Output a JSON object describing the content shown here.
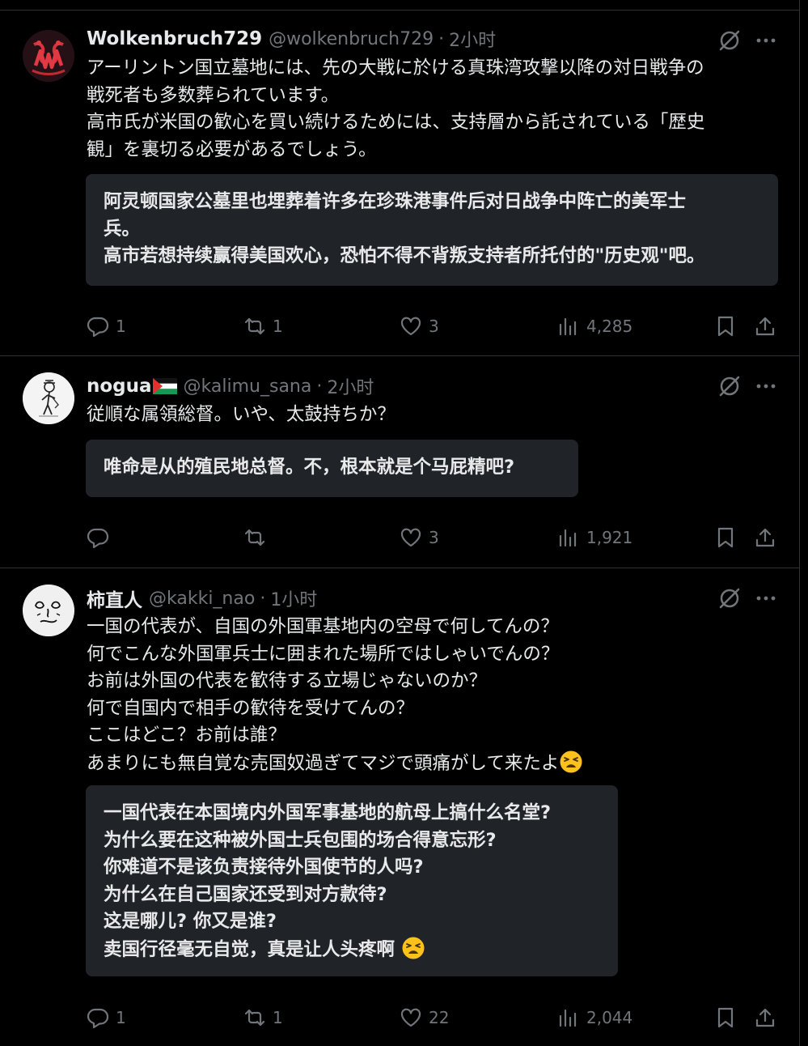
{
  "tweets": [
    {
      "name": "Wolkenbruch729",
      "handle": "@wolkenbruch729",
      "dot": "·",
      "time": "2小时",
      "avatar_icon": "red-gothic-w-monogram",
      "text": [
        "アーリントン国立墓地には、先の大戦に於ける真珠湾攻撃以降の対日戦争の",
        "戦死者も多数葬られています。",
        "高市氏が米国の歓心を買い続けるためには、支持層から託されている「歴史",
        "観」を裏切る必要があるでしょう。"
      ],
      "translation": [
        "阿灵顿国家公墓里也埋葬着许多在珍珠港事件后对日战争中阵亡的美军士",
        "兵。",
        "高市若想持续赢得美国欢心，恐怕不得不背叛支持者所托付的\"历史观\"吧。"
      ],
      "replies": "1",
      "reposts": "1",
      "likes": "3",
      "views": "4,285"
    },
    {
      "name": "nogua",
      "flag_icon": "palestine-flag",
      "handle": "@kalimu_sana",
      "dot": "·",
      "time": "2小时",
      "avatar_icon": "sketch-figure-avatar",
      "text": [
        "従順な属領総督。いや、太鼓持ちか？"
      ],
      "translation": [
        "唯命是从的殖民地总督。不，根本就是个马屁精吧?"
      ],
      "replies": "",
      "reposts": "",
      "likes": "3",
      "views": "1,921"
    },
    {
      "name": "柿直人",
      "handle": "@kakki_nao",
      "dot": "·",
      "time": "1小时",
      "avatar_icon": "doodle-face-avatar",
      "text": [
        "一国の代表が、自国の外国軍基地内の空母で何してんの？",
        "何でこんな外国軍兵士に囲まれた場所ではしゃいでんの？",
        "お前は外国の代表を歓待する立場じゃないのか？",
        "何で自国内で相手の歓待を受けてんの？",
        "ここはどこ？お前は誰？",
        "あまりにも無自覚な売国奴過ぎてマジで頭痛がして来たよ"
      ],
      "translation": [
        "一国代表在本国境内外国军事基地的航母上搞什么名堂?",
        "为什么要在这种被外国士兵包围的场合得意忘形?",
        "你难道不是该负责接待外国使节的人吗?",
        "为什么在自己国家还受到对方款待?",
        "这是哪儿? 你又是谁?",
        "卖国行径毫无自觉，真是让人头疼啊"
      ],
      "emoji_icon": "tired-face-emoji",
      "replies": "1",
      "reposts": "1",
      "likes": "22",
      "views": "2,044"
    }
  ],
  "colors": {
    "background": "#000000",
    "text": "#e7e9ea",
    "muted": "#71767b",
    "translation_box": "#202327",
    "divider": "#2f3336"
  }
}
